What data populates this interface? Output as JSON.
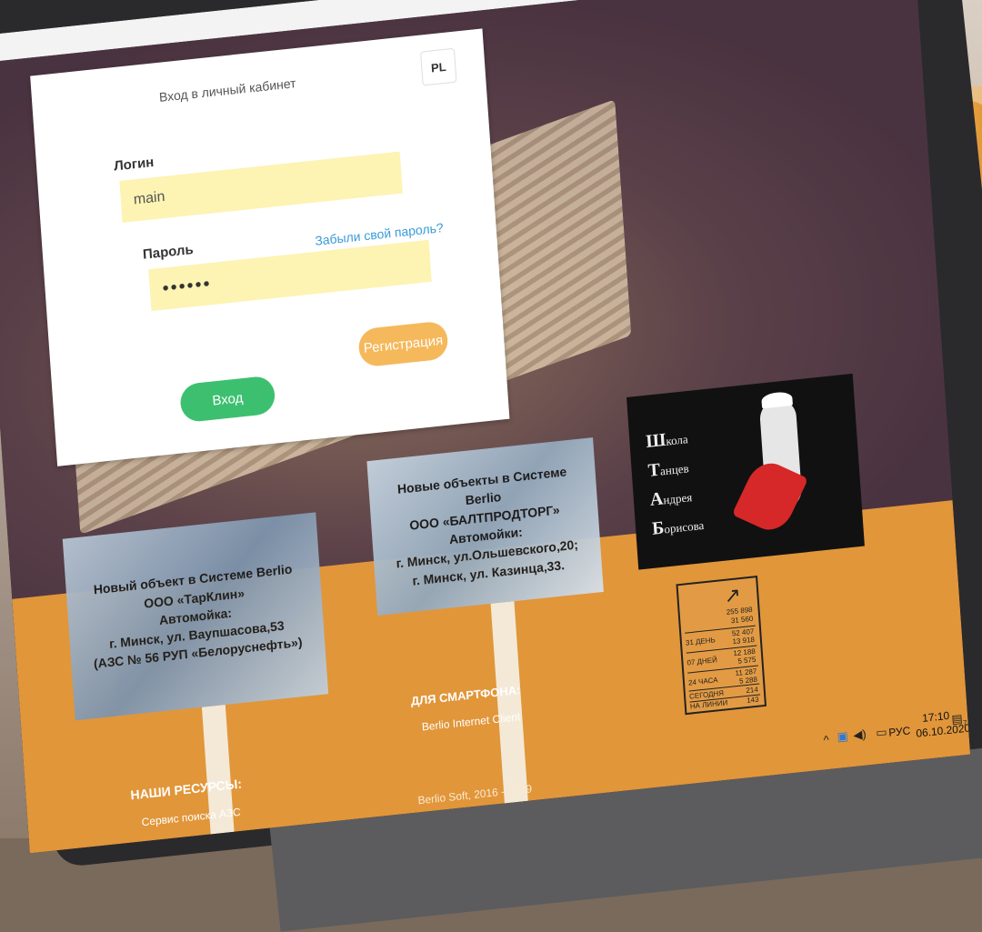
{
  "login": {
    "title": "Вход в личный кабинет",
    "lang": "PL",
    "login_label": "Логин",
    "login_value": "main",
    "password_label": "Пароль",
    "password_value": "••••••",
    "forgot": "Забыли свой пароль?",
    "submit": "Вход",
    "register": "Регистрация"
  },
  "news": [
    {
      "lines": [
        "Новый объект в Системе Berlio",
        "ООО «ТарКлин»",
        "Автомойка:",
        "г. Минск, ул. Ваупшасова,53",
        "(АЗС № 56 РУП «Белоруснефть»)"
      ]
    },
    {
      "lines": [
        "Новые объекты в Системе Berlio",
        "ООО «БАЛТПРОДТОРГ»",
        "Автомойки:",
        "г. Минск, ул.Ольшевского,20;",
        "г. Минск, ул. Казинца,33."
      ]
    }
  ],
  "dance": {
    "lines": [
      {
        "cap": "Ш",
        "rest": "кола"
      },
      {
        "cap": "Т",
        "rest": "анцев"
      },
      {
        "cap": "А",
        "rest": "ндрея"
      },
      {
        "cap": "Б",
        "rest": "орисова"
      }
    ]
  },
  "footer": {
    "smartphone_heading": "ДЛЯ СМАРТФОНА:",
    "smartphone_link": "Berlio Internet Client",
    "resources_heading": "НАШИ РЕСУРСЫ:",
    "resources_link": "Сервис поиска АЗС",
    "copyright": "Berlio Soft, 2016 - 2019"
  },
  "stats": {
    "top": [
      "255 898",
      "31 560"
    ],
    "rows": [
      {
        "label": "31 ДЕНЬ",
        "v1": "52 407",
        "v2": "13 918"
      },
      {
        "label": "07 ДНЕЙ",
        "v1": "12 188",
        "v2": "5 575"
      },
      {
        "label": "24 ЧАСА",
        "v1": "11 287",
        "v2": "5 288"
      },
      {
        "label": "СЕГОДНЯ",
        "v1": "214",
        "v2": "143"
      },
      {
        "label": "НА ЛИНИИ",
        "v1": "",
        "v2": ""
      }
    ]
  },
  "taskbar": {
    "lang": "РУС",
    "time": "17:10",
    "date": "06.10.2020",
    "notification_count": "7"
  }
}
